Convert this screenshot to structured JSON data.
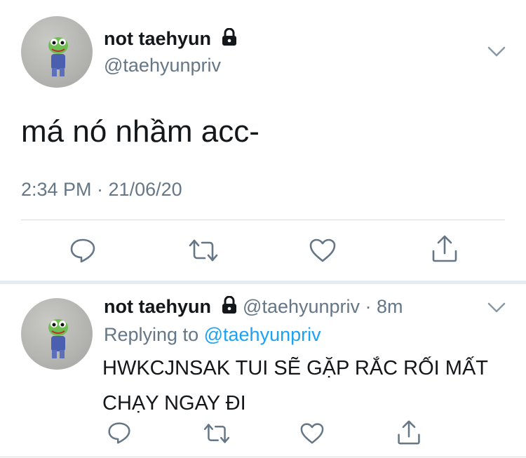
{
  "main_tweet": {
    "display_name": "not taehyun",
    "handle": "@taehyunpriv",
    "text": "má nó nhầm acc-",
    "timestamp": "2:34 PM · 21/06/20"
  },
  "reply_tweet": {
    "display_name": "not taehyun",
    "handle": "@taehyunpriv",
    "age": "· 8m",
    "replying_prefix": "Replying to",
    "replying_to": "@taehyunpriv",
    "text": "HWKCJNSAK TUI SẼ GẶP RẮC RỐI MẤT CHẠY NGAY ĐI"
  },
  "icons": [
    "lock-icon",
    "chevron-down-icon",
    "reply-icon",
    "retweet-icon",
    "like-icon",
    "share-icon"
  ],
  "colors": {
    "text": "#14171a",
    "muted": "#657786",
    "link": "#1da1f2",
    "divider": "#e6ecf0"
  }
}
